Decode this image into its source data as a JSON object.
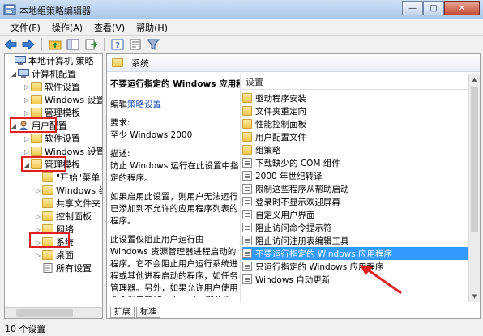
{
  "window": {
    "title": "本地组策略编辑器",
    "minimize": "—",
    "maximize": "□",
    "close": "✕"
  },
  "menu": [
    "文件(F)",
    "操作(A)",
    "查看(V)",
    "帮助(H)"
  ],
  "toolbar": [
    "back-icon",
    "forward-icon",
    "up-folder-icon",
    "show-hide-tree-icon",
    "export-icon",
    "help-icon",
    "properties-icon",
    "filter-icon"
  ],
  "tree": [
    {
      "label": "本地计算机 策略",
      "indent": 0,
      "exp": "",
      "icon": "computer-policy-icon"
    },
    {
      "label": "计算机配置",
      "indent": 1,
      "exp": "◢",
      "icon": "computer-icon"
    },
    {
      "label": "软件设置",
      "indent": 2,
      "exp": "▷",
      "icon": "folder-icon"
    },
    {
      "label": "Windows 设置",
      "indent": 2,
      "exp": "▷",
      "icon": "folder-icon"
    },
    {
      "label": "管理模板",
      "indent": 2,
      "exp": "▷",
      "icon": "folder-icon"
    },
    {
      "label": "用户配置",
      "indent": 1,
      "exp": "◢",
      "icon": "user-icon"
    },
    {
      "label": "软件设置",
      "indent": 2,
      "exp": "▷",
      "icon": "folder-icon"
    },
    {
      "label": "Windows 设置",
      "indent": 2,
      "exp": "▷",
      "icon": "folder-icon"
    },
    {
      "label": "管理模板",
      "indent": 2,
      "exp": "◢",
      "icon": "folder-icon"
    },
    {
      "label": "\"开始\"菜单",
      "indent": 3,
      "exp": "",
      "icon": "folder-icon"
    },
    {
      "label": "Windows 组件",
      "indent": 3,
      "exp": "▷",
      "icon": "folder-icon"
    },
    {
      "label": "共享文件夹",
      "indent": 3,
      "exp": "",
      "icon": "folder-icon"
    },
    {
      "label": "控制面板",
      "indent": 3,
      "exp": "▷",
      "icon": "folder-icon"
    },
    {
      "label": "网络",
      "indent": 3,
      "exp": "▷",
      "icon": "folder-icon"
    },
    {
      "label": "系统",
      "indent": 3,
      "exp": "▷",
      "icon": "folder-icon"
    },
    {
      "label": "桌面",
      "indent": 3,
      "exp": "▷",
      "icon": "folder-icon"
    },
    {
      "label": "所有设置",
      "indent": 3,
      "exp": "",
      "icon": "all-settings-icon"
    }
  ],
  "right_header": "系统",
  "description": {
    "heading": "不要运行指定的 Windows 应用程序",
    "edit_prefix": "编辑",
    "edit_link": "策略设置",
    "requirement_label": "要求:",
    "requirement": "至少 Windows 2000",
    "desc_label": "描述:",
    "desc1": "防止 Windows 运行在此设置中指定的程序。",
    "desc2": "如果启用此设置，则用户无法运行已添加到不允许的应用程序列表的程序。",
    "desc3": "此设置仅阻止用户运行由 Windows 资源管理器进程启动的程序。它不会阻止用户运行系统进程或其他进程启动的程序，如任务管理器。另外，如果允许用户使用命令提示符(Cmd.exe)，则此设"
  },
  "list": {
    "header": "设置",
    "items": [
      {
        "label": "驱动程序安装",
        "type": "folder"
      },
      {
        "label": "文件夹重定向",
        "type": "folder"
      },
      {
        "label": "性能控制面板",
        "type": "folder"
      },
      {
        "label": "用户配置文件",
        "type": "folder"
      },
      {
        "label": "组策略",
        "type": "folder"
      },
      {
        "label": "下载缺少的 COM 组件",
        "type": "setting"
      },
      {
        "label": "2000 年世纪转译",
        "type": "setting"
      },
      {
        "label": "限制这些程序从帮助启动",
        "type": "setting"
      },
      {
        "label": "登录时不显示欢迎屏幕",
        "type": "setting"
      },
      {
        "label": "自定义用户界面",
        "type": "setting"
      },
      {
        "label": "阻止访问命令提示符",
        "type": "setting"
      },
      {
        "label": "阻止访问注册表编辑工具",
        "type": "setting"
      },
      {
        "label": "不要运行指定的 Windows 应用程序",
        "type": "setting",
        "selected": true
      },
      {
        "label": "只运行指定的 Windows 应用程序",
        "type": "setting"
      },
      {
        "label": "Windows 自动更新",
        "type": "setting"
      }
    ]
  },
  "tabs": [
    "扩展",
    "标准"
  ],
  "status": "10 个设置",
  "colors": {
    "highlight": "#3399ff",
    "annotation": "#e02020",
    "link": "#1a50b8"
  }
}
